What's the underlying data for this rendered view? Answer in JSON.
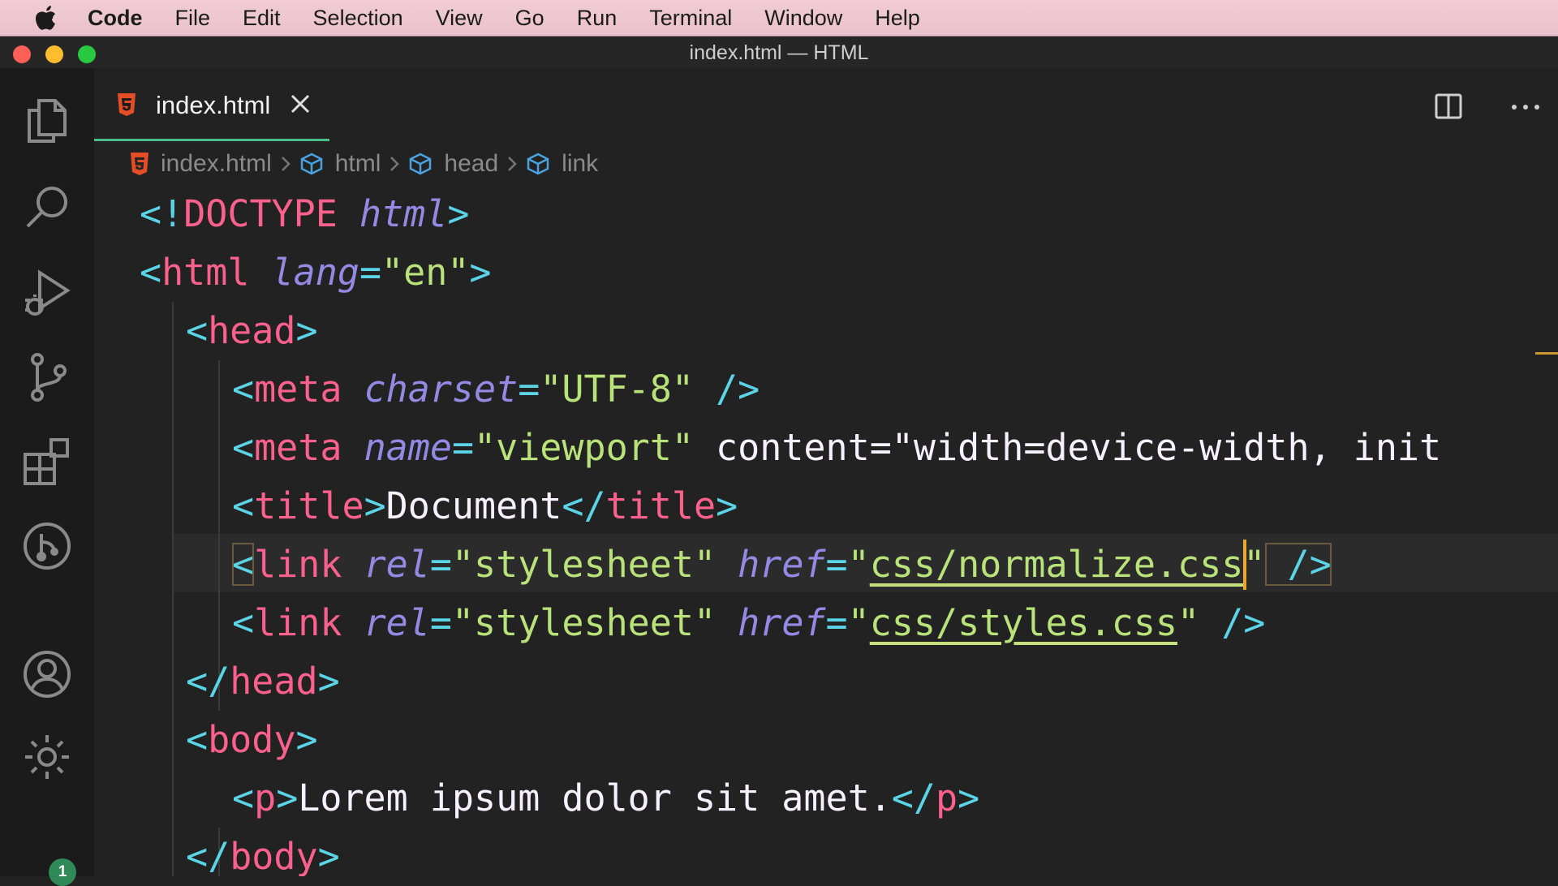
{
  "menubar": {
    "app_name": "Code",
    "items": [
      "File",
      "Edit",
      "Selection",
      "View",
      "Go",
      "Run",
      "Terminal",
      "Window",
      "Help"
    ]
  },
  "window": {
    "title": "index.html — HTML"
  },
  "tab": {
    "label": "index.html"
  },
  "breadcrumb": [
    "index.html",
    "html",
    "head",
    "link"
  ],
  "activity": {
    "settings_badge": "1"
  },
  "editor": {
    "lines": [
      "<!DOCTYPE html>",
      "<html lang=\"en\">",
      "<head>",
      "<meta charset=\"UTF-8\" />",
      "<meta name=\"viewport\" content=\"width=device-width, init",
      "<title>Document</title>",
      "<link rel=\"stylesheet\" href=\"css/normalize.css\" />",
      "<link rel=\"stylesheet\" href=\"css/styles.css\" />",
      "</head>",
      "<body>",
      "<p>Lorem ipsum dolor sit amet.</p>",
      "</body>"
    ]
  },
  "colors": {
    "punctuation": "#5ad4e6",
    "tag": "#fc618d",
    "attribute": "#948ae3",
    "string": "#b9e27a",
    "text": "#f7f1ff",
    "tab_underline": "#4bbd8b",
    "cursor": "#f0a430"
  }
}
